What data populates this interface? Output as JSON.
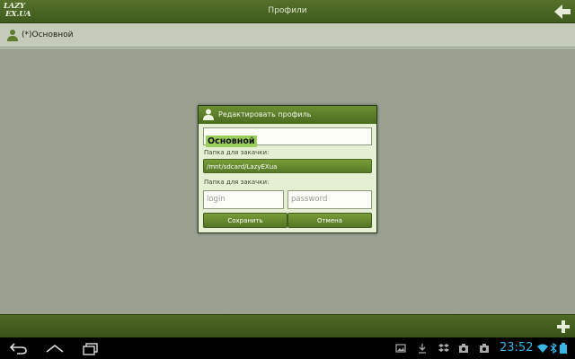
{
  "app": {
    "logo_line1": "LAZY",
    "logo_line2": "EX.UA",
    "title": "Профили"
  },
  "profile_list": {
    "items": [
      {
        "label": "(*)Основной"
      }
    ]
  },
  "dialog": {
    "title": "Редактировать профиль",
    "profile_name": "Основной",
    "folder_label": "Папка для закачки:",
    "folder_path": "/mnt/sdcard/LazyEXua",
    "credentials_label": "Папка для закачки:",
    "login_placeholder": "login",
    "password_placeholder": "password",
    "save_label": "Сохранить",
    "cancel_label": "Отмена"
  },
  "status_bar": {
    "time": "23:52"
  },
  "icons": {
    "back": "arrow-left-icon",
    "add": "plus-icon",
    "profile": "user-icon",
    "nav_back": "back-icon",
    "nav_home": "home-icon",
    "nav_recent": "recent-apps-icon"
  },
  "colors": {
    "accent_green": "#557927",
    "clock_blue": "#38b6e6",
    "selection": "#9acf5e"
  }
}
